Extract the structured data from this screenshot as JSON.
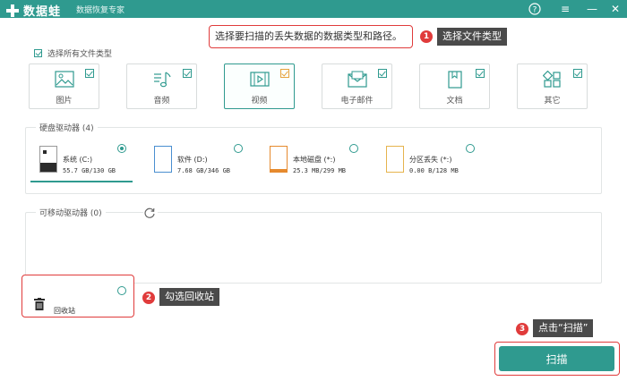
{
  "titlebar": {
    "app_name": "数据蛙",
    "subtitle": "数据恢复专家",
    "help": "?",
    "menu": "≡",
    "minimize": "—",
    "close": "✕"
  },
  "instruction": "选择要扫描的丢失数据的数据类型和路径。",
  "steps": [
    {
      "num": "1",
      "text": "选择文件类型"
    },
    {
      "num": "2",
      "text": "勾选回收站"
    },
    {
      "num": "3",
      "text": "点击“扫描”"
    }
  ],
  "select_all_label": "选择所有文件类型",
  "file_types": [
    {
      "label": "图片",
      "icon": "image-icon",
      "checked": true
    },
    {
      "label": "音频",
      "icon": "audio-icon",
      "checked": true
    },
    {
      "label": "视频",
      "icon": "video-icon",
      "checked": true,
      "selected": true
    },
    {
      "label": "电子邮件",
      "icon": "email-icon",
      "checked": true
    },
    {
      "label": "文档",
      "icon": "document-icon",
      "checked": true
    },
    {
      "label": "其它",
      "icon": "other-icon",
      "checked": true
    }
  ],
  "hard_drives": {
    "title": "硬盘驱动器 (4)",
    "drives": [
      {
        "name": "系统 (C:)",
        "size": "55.7 GB/130 GB",
        "icon": "system-drive-icon",
        "selected": true
      },
      {
        "name": "软件 (D:)",
        "size": "7.68 GB/346 GB",
        "icon": "drive-icon",
        "selected": false
      },
      {
        "name": "本地磁盘 (*:)",
        "size": "25.3 MB/299 MB",
        "icon": "drive-icon",
        "selected": false
      },
      {
        "name": "分区丢失 (*:)",
        "size": "0.00 B/128 MB",
        "icon": "lost-partition-icon",
        "selected": false
      }
    ]
  },
  "removable": {
    "title": "可移动驱动器 (0)"
  },
  "recycle_bin": {
    "label": "回收站"
  },
  "scan_button": "扫描",
  "colors": {
    "accent": "#2f9a8f",
    "highlight": "#e03b3b"
  }
}
